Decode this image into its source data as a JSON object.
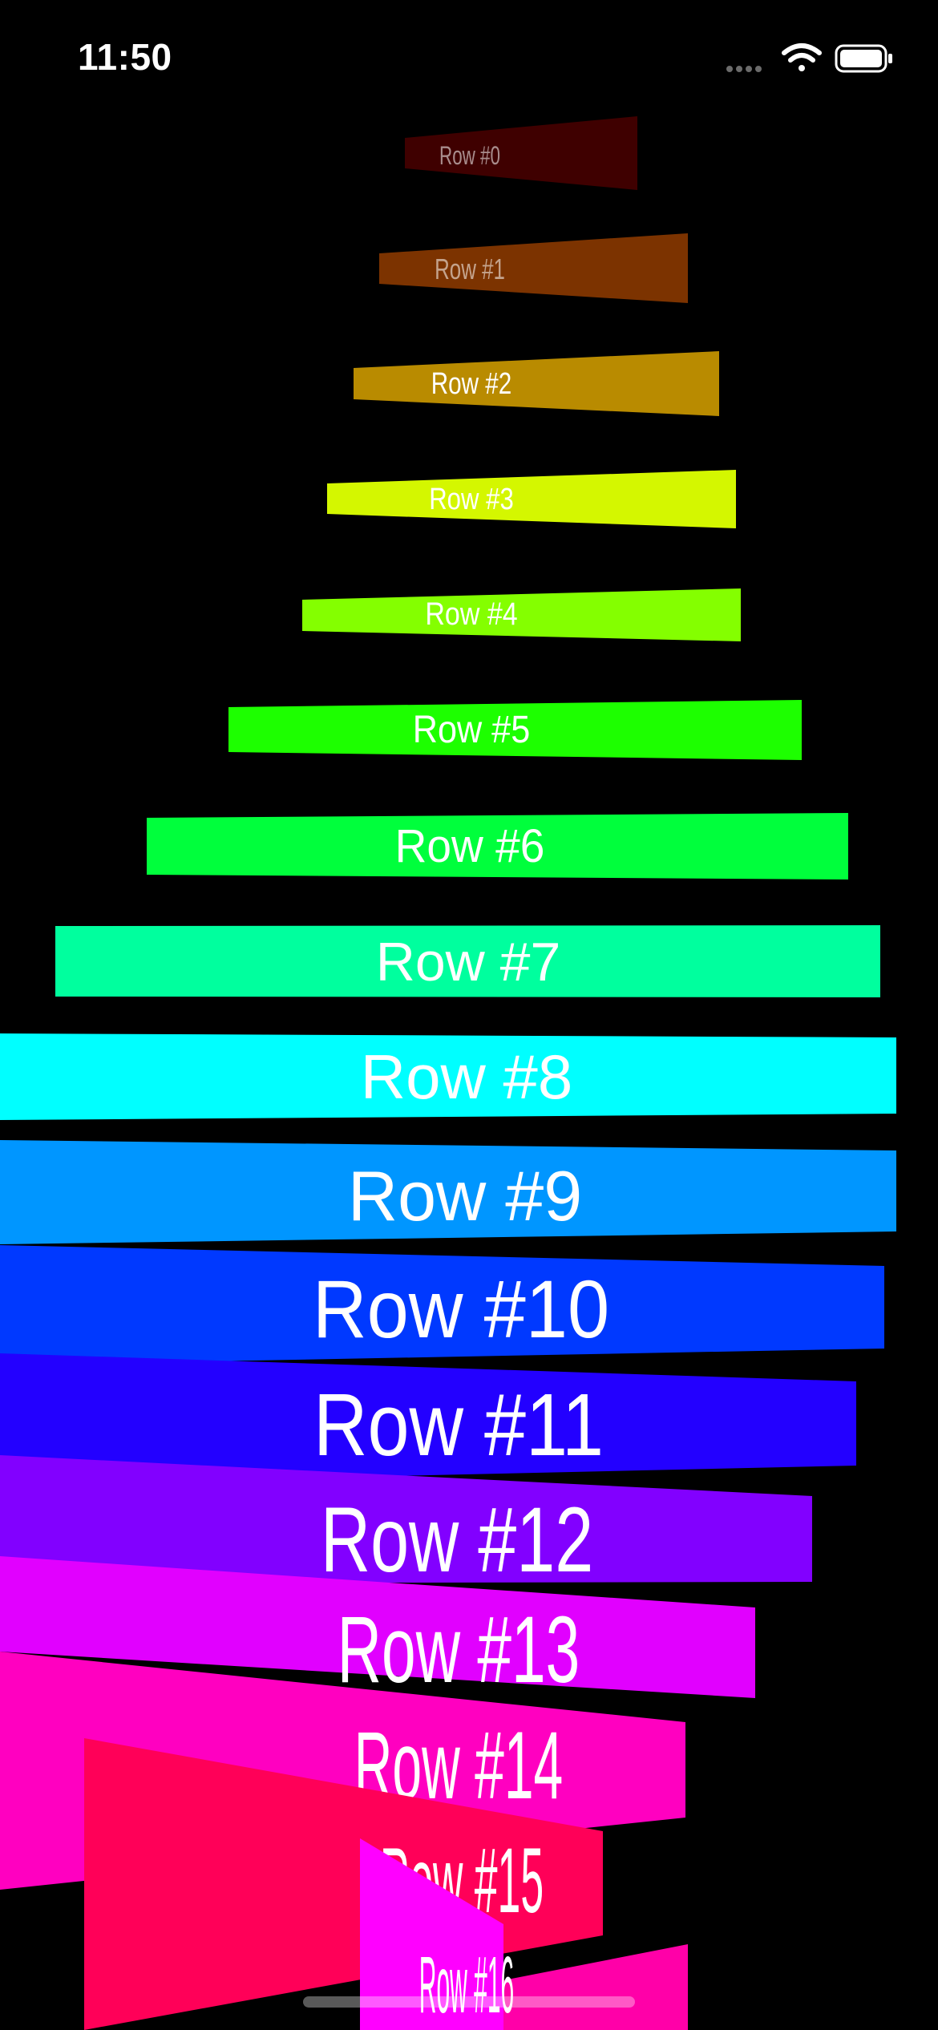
{
  "status_bar": {
    "time": "11:50",
    "icons": [
      "signal-dots-icon",
      "wifi-icon",
      "battery-icon"
    ]
  },
  "rows": [
    {
      "label": "Row #0",
      "color": "#3f0000"
    },
    {
      "label": "Row #1",
      "color": "#7c3300"
    },
    {
      "label": "Row #2",
      "color": "#b98b00"
    },
    {
      "label": "Row #3",
      "color": "#d4f700"
    },
    {
      "label": "Row #4",
      "color": "#84ff00"
    },
    {
      "label": "Row #5",
      "color": "#1dff00"
    },
    {
      "label": "Row #6",
      "color": "#00ff3c"
    },
    {
      "label": "Row #7",
      "color": "#00ff9e"
    },
    {
      "label": "Row #8",
      "color": "#00ffff"
    },
    {
      "label": "Row #9",
      "color": "#0096ff"
    },
    {
      "label": "Row #10",
      "color": "#0039ff"
    },
    {
      "label": "Row #11",
      "color": "#2300ff"
    },
    {
      "label": "Row #12",
      "color": "#8200ff"
    },
    {
      "label": "Row #13",
      "color": "#e100ff"
    },
    {
      "label": "Row #14",
      "color": "#ff00c0"
    },
    {
      "label": "Row #15",
      "color": "#ff0058"
    },
    {
      "label": "Row #16",
      "color": "#ff00ff"
    }
  ]
}
